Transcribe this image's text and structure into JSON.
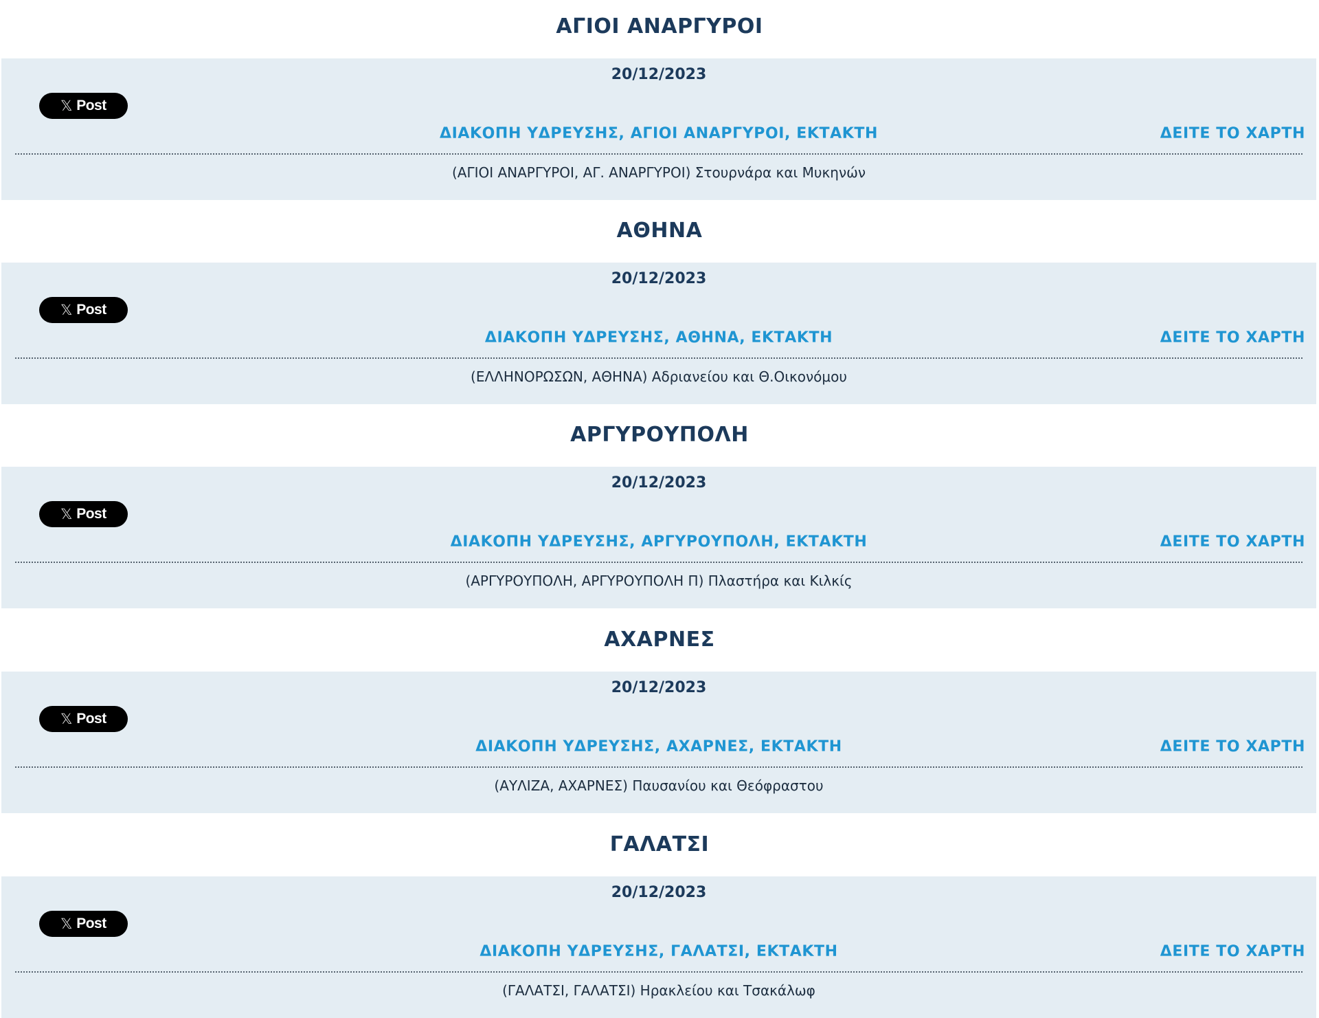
{
  "post_button": {
    "icon": "x-logo-icon",
    "icon_glyph": "𝕏",
    "label": "Post"
  },
  "map_link_label": "ΔΕΙΤΕ ΤΟ ΧΑΡΤΗ",
  "areas": [
    {
      "heading": "ΑΓΙΟΙ ΑΝΑΡΓΥΡΟΙ",
      "date": "20/12/2023",
      "title": "ΔΙΑΚΟΠΗ ΥΔΡΕΥΣΗΣ, ΑΓΙΟΙ ΑΝΑΡΓΥΡΟΙ, ΕΚΤΑΚΤΗ",
      "description": "(ΑΓΙΟΙ ΑΝΑΡΓΥΡΟΙ, ΑΓ. ΑΝΑΡΓΥΡΟΙ) Στουρνάρα και Μυκηνών"
    },
    {
      "heading": "ΑΘΗΝΑ",
      "date": "20/12/2023",
      "title": "ΔΙΑΚΟΠΗ ΥΔΡΕΥΣΗΣ, ΑΘΗΝΑ, ΕΚΤΑΚΤΗ",
      "description": "(ΕΛΛΗΝΟΡΩΣΩΝ, ΑΘΗΝΑ) Αδριανείου και Θ.Οικονόμου"
    },
    {
      "heading": "ΑΡΓΥΡΟΥΠΟΛΗ",
      "date": "20/12/2023",
      "title": "ΔΙΑΚΟΠΗ ΥΔΡΕΥΣΗΣ, ΑΡΓΥΡΟΥΠΟΛΗ, ΕΚΤΑΚΤΗ",
      "description": "(ΑΡΓΥΡΟΥΠΟΛΗ, ΑΡΓΥΡΟΥΠΟΛΗ Π) Πλαστήρα και Κιλκίς"
    },
    {
      "heading": "ΑΧΑΡΝΕΣ",
      "date": "20/12/2023",
      "title": "ΔΙΑΚΟΠΗ ΥΔΡΕΥΣΗΣ, ΑΧΑΡΝΕΣ, ΕΚΤΑΚΤΗ",
      "description": "(ΑΥΛΙΖΑ, ΑΧΑΡΝΕΣ) Παυσανίου και Θεόφραστου"
    },
    {
      "heading": "ΓΑΛΑΤΣΙ",
      "date": "20/12/2023",
      "title": "ΔΙΑΚΟΠΗ ΥΔΡΕΥΣΗΣ, ΓΑΛΑΤΣΙ, ΕΚΤΑΚΤΗ",
      "description": "(ΓΑΛΑΤΣΙ, ΓΑΛΑΤΣΙ) Ηρακλείου και Τσακάλωφ"
    }
  ]
}
